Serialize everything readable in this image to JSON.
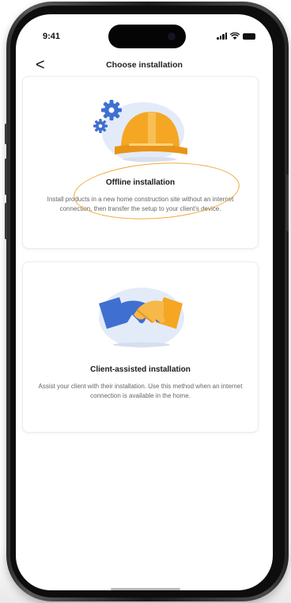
{
  "status_bar": {
    "time": "9:41"
  },
  "header": {
    "back_glyph": "<",
    "title": "Choose installation"
  },
  "cards": [
    {
      "title": "Offline installation",
      "description": "Install products in a new home construction site without an internet connection, then transfer the setup to your client's device.",
      "illustration": "hard-hat-with-gears-icon"
    },
    {
      "title": "Client-assisted installation",
      "description": "Assist your client with their installation. Use this method when an internet connection is available in the home.",
      "illustration": "handshake-icon"
    }
  ],
  "colors": {
    "accent_orange": "#f2a93a",
    "illustration_blue": "#3f6fd1",
    "illustration_bg": "#e3ebf8"
  }
}
